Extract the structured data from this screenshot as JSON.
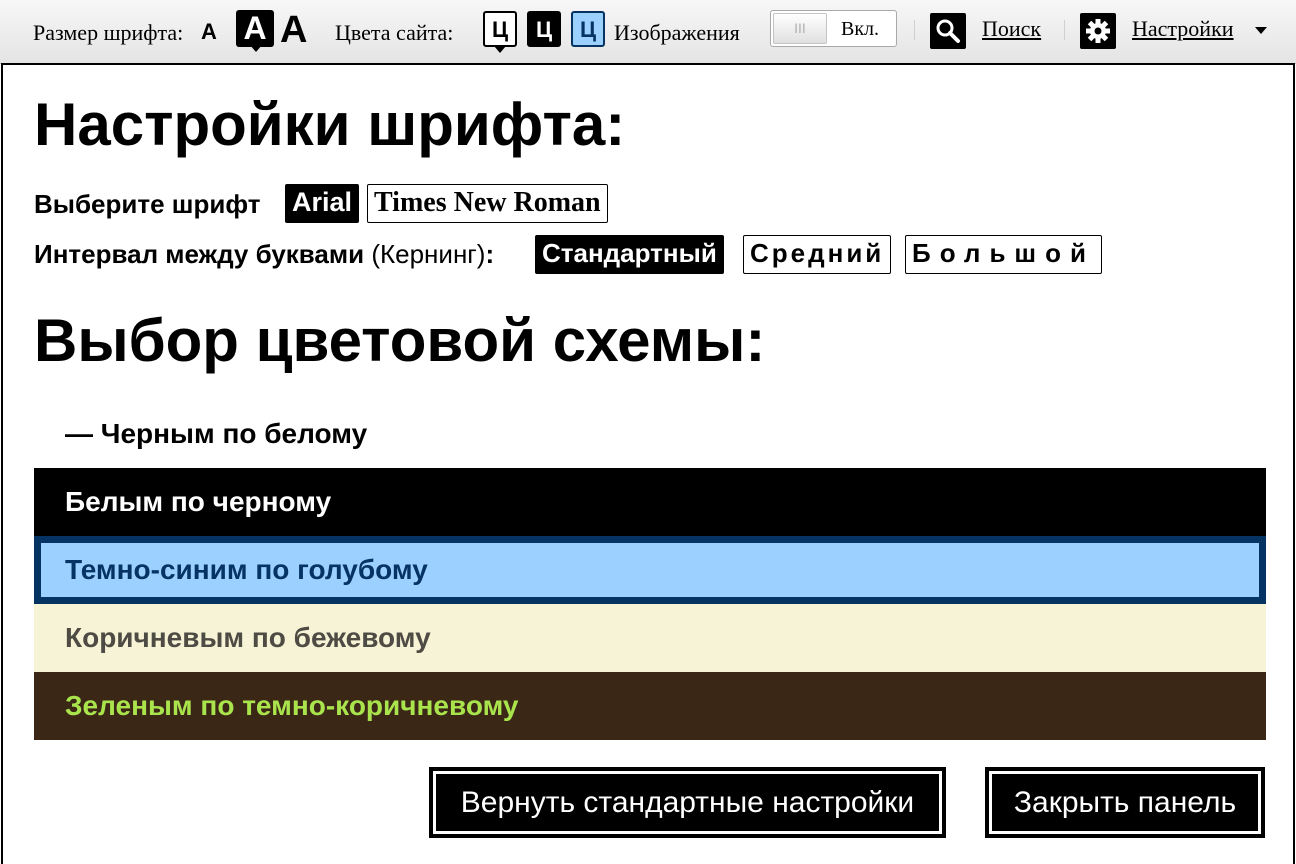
{
  "toolbar": {
    "font_size_label": "Размер шрифта:",
    "font_size_small": "A",
    "font_size_medium": "A",
    "font_size_large": "A",
    "colors_label": "Цвета сайта:",
    "color_scheme_1": "Ц",
    "color_scheme_2": "Ц",
    "color_scheme_3": "Ц",
    "images_label": "Изображения",
    "images_toggle_text": "Вкл.",
    "images_toggle_knob": "III",
    "search_label": "Поиск",
    "settings_label": "Настройки"
  },
  "panel": {
    "font_title": "Настройки шрифта:",
    "font_choice_label": "Выберите шрифт",
    "fonts": [
      "Arial",
      "Times New Roman"
    ],
    "kerning_label_bold": "Интервал между буквами",
    "kerning_label_paren": " (Кернинг)",
    "kerning_colon": ":",
    "kerning_options": [
      "Стандартный",
      "Средний",
      "Большой"
    ],
    "color_title": "Выбор цветовой схемы:",
    "schemes": [
      "— Черным по белому",
      "Белым по черному",
      "Темно-синим по голубому",
      "Коричневым по бежевому",
      "Зеленым по темно-коричневому"
    ],
    "reset_button": "Вернуть стандартные настройки",
    "close_button": "Закрыть панель"
  },
  "colors": {
    "blue_scheme_bg": "#9cd0ff",
    "blue_scheme_fg": "#063462",
    "beige_scheme_bg": "#f7f3d6",
    "beige_scheme_fg": "#4d4b43",
    "green_scheme_bg": "#3b2716",
    "green_scheme_fg": "#a9e44d"
  },
  "icons": {
    "search": "search-icon",
    "settings": "gear-icon",
    "dropdown": "chevron-down-icon"
  }
}
